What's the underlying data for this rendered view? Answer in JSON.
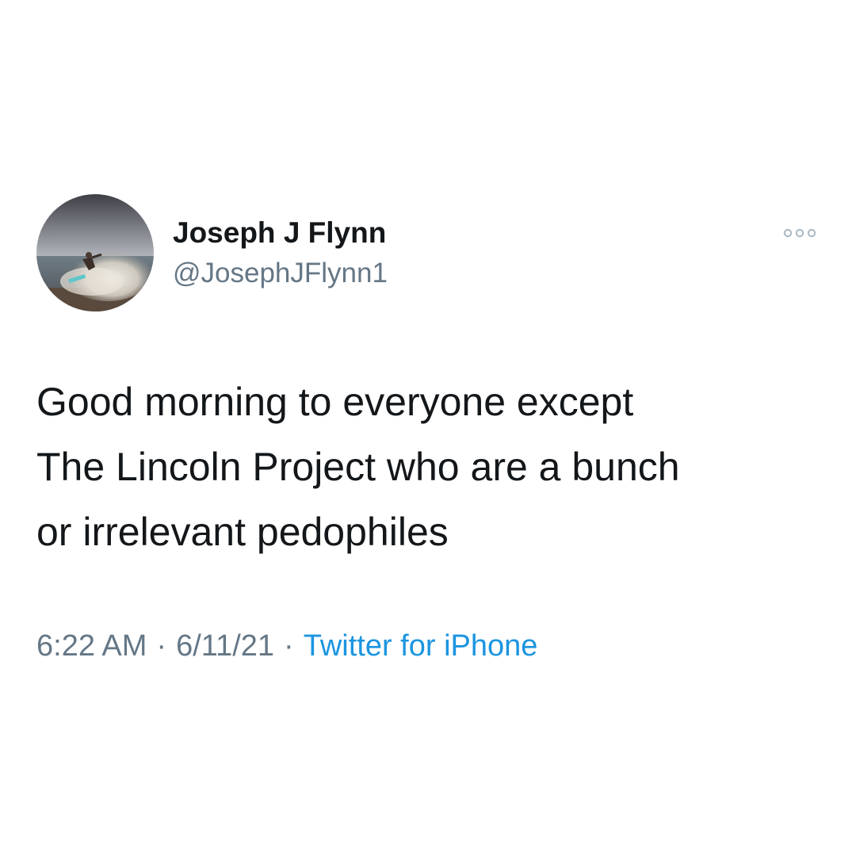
{
  "tweet": {
    "author": {
      "display_name": "Joseph J Flynn",
      "handle": "@JosephJFlynn1",
      "avatar_icon": "surfer-photo-avatar"
    },
    "more_icon": "more-options-icon",
    "text_lines": [
      "Good morning to everyone except",
      "The Lincoln Project who are a bunch",
      "or irrelevant pedophiles"
    ],
    "time": "6:22 AM",
    "separator": "·",
    "date": "6/11/21",
    "source": "Twitter for iPhone"
  },
  "colors": {
    "text": "#14171a",
    "secondary": "#657786",
    "link": "#1b95e0",
    "background": "#ffffff"
  }
}
